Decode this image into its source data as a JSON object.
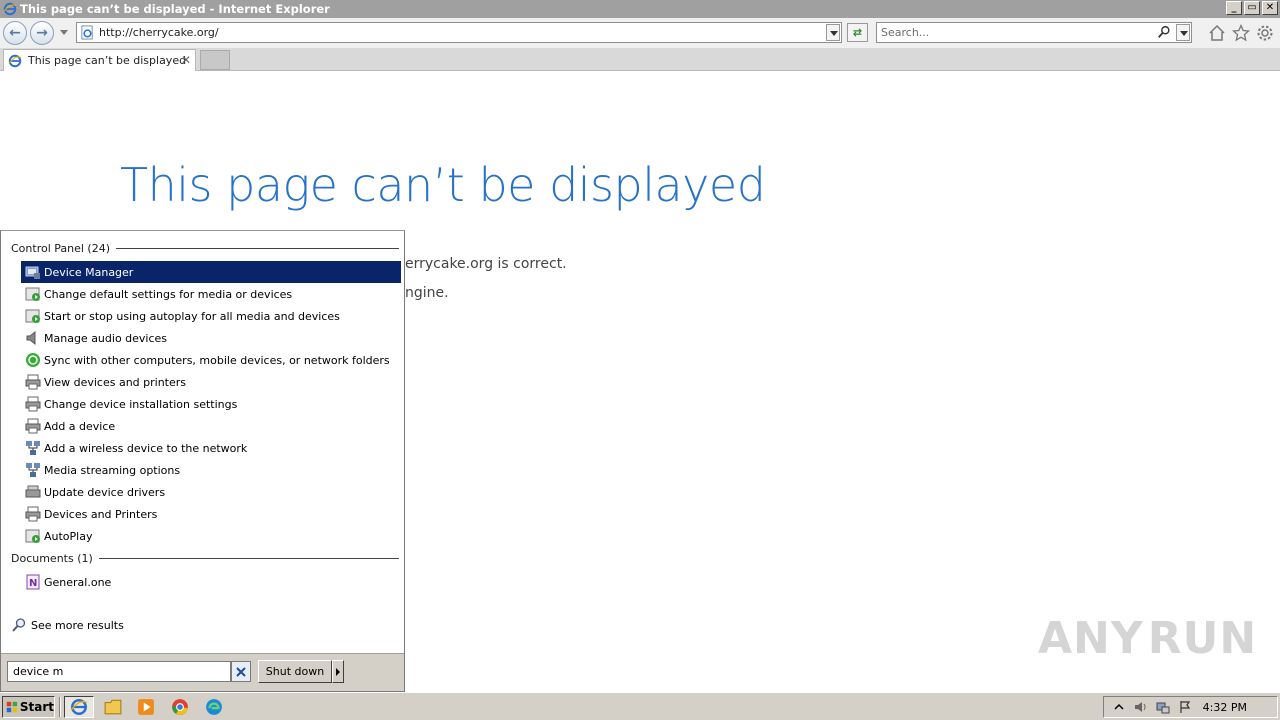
{
  "window": {
    "title": "This page can’t be displayed - Internet Explorer",
    "controls": [
      "_",
      "▭",
      "✕"
    ]
  },
  "navbar": {
    "url": "http://cherrycake.org/",
    "search_placeholder": "Search..."
  },
  "tabs": [
    {
      "label": "This page can’t be displayed",
      "close": "✕"
    }
  ],
  "page": {
    "heading": "This page can’t be displayed",
    "line1": "errycake.org is correct.",
    "line2": "ngine."
  },
  "start_menu": {
    "groups": [
      {
        "label": "Control Panel (24)",
        "items": [
          {
            "label": "Device Manager",
            "icon": "device-manager-icon",
            "selected": true
          },
          {
            "label": "Change default settings for media or devices",
            "icon": "autoplay-icon"
          },
          {
            "label": "Start or stop using autoplay for all media and devices",
            "icon": "autoplay-icon"
          },
          {
            "label": "Manage audio devices",
            "icon": "speaker-icon"
          },
          {
            "label": "Sync with other computers, mobile devices, or network folders",
            "icon": "sync-center-icon"
          },
          {
            "label": "View devices and printers",
            "icon": "printer-icon"
          },
          {
            "label": "Change device installation settings",
            "icon": "printer-icon"
          },
          {
            "label": "Add a device",
            "icon": "printer-icon"
          },
          {
            "label": "Add a wireless device to the network",
            "icon": "network-icon"
          },
          {
            "label": "Media streaming options",
            "icon": "network-icon"
          },
          {
            "label": "Update device drivers",
            "icon": "device-manager-icon"
          },
          {
            "label": "Devices and Printers",
            "icon": "printer-icon"
          },
          {
            "label": "AutoPlay",
            "icon": "autoplay-icon"
          }
        ]
      },
      {
        "label": "Documents (1)",
        "items": [
          {
            "label": "General.one",
            "icon": "onenote-icon"
          }
        ]
      }
    ],
    "see_more": "See more results",
    "search_value": "device m",
    "shutdown_label": "Shut down"
  },
  "taskbar": {
    "start_label": "Start",
    "clock": "4:32 PM"
  },
  "watermark": {
    "left": "ANY",
    "right": "RUN"
  },
  "colors": {
    "heading": "#2672c8",
    "selection": "#0a246a",
    "title_bar": "#a0a0a0"
  }
}
